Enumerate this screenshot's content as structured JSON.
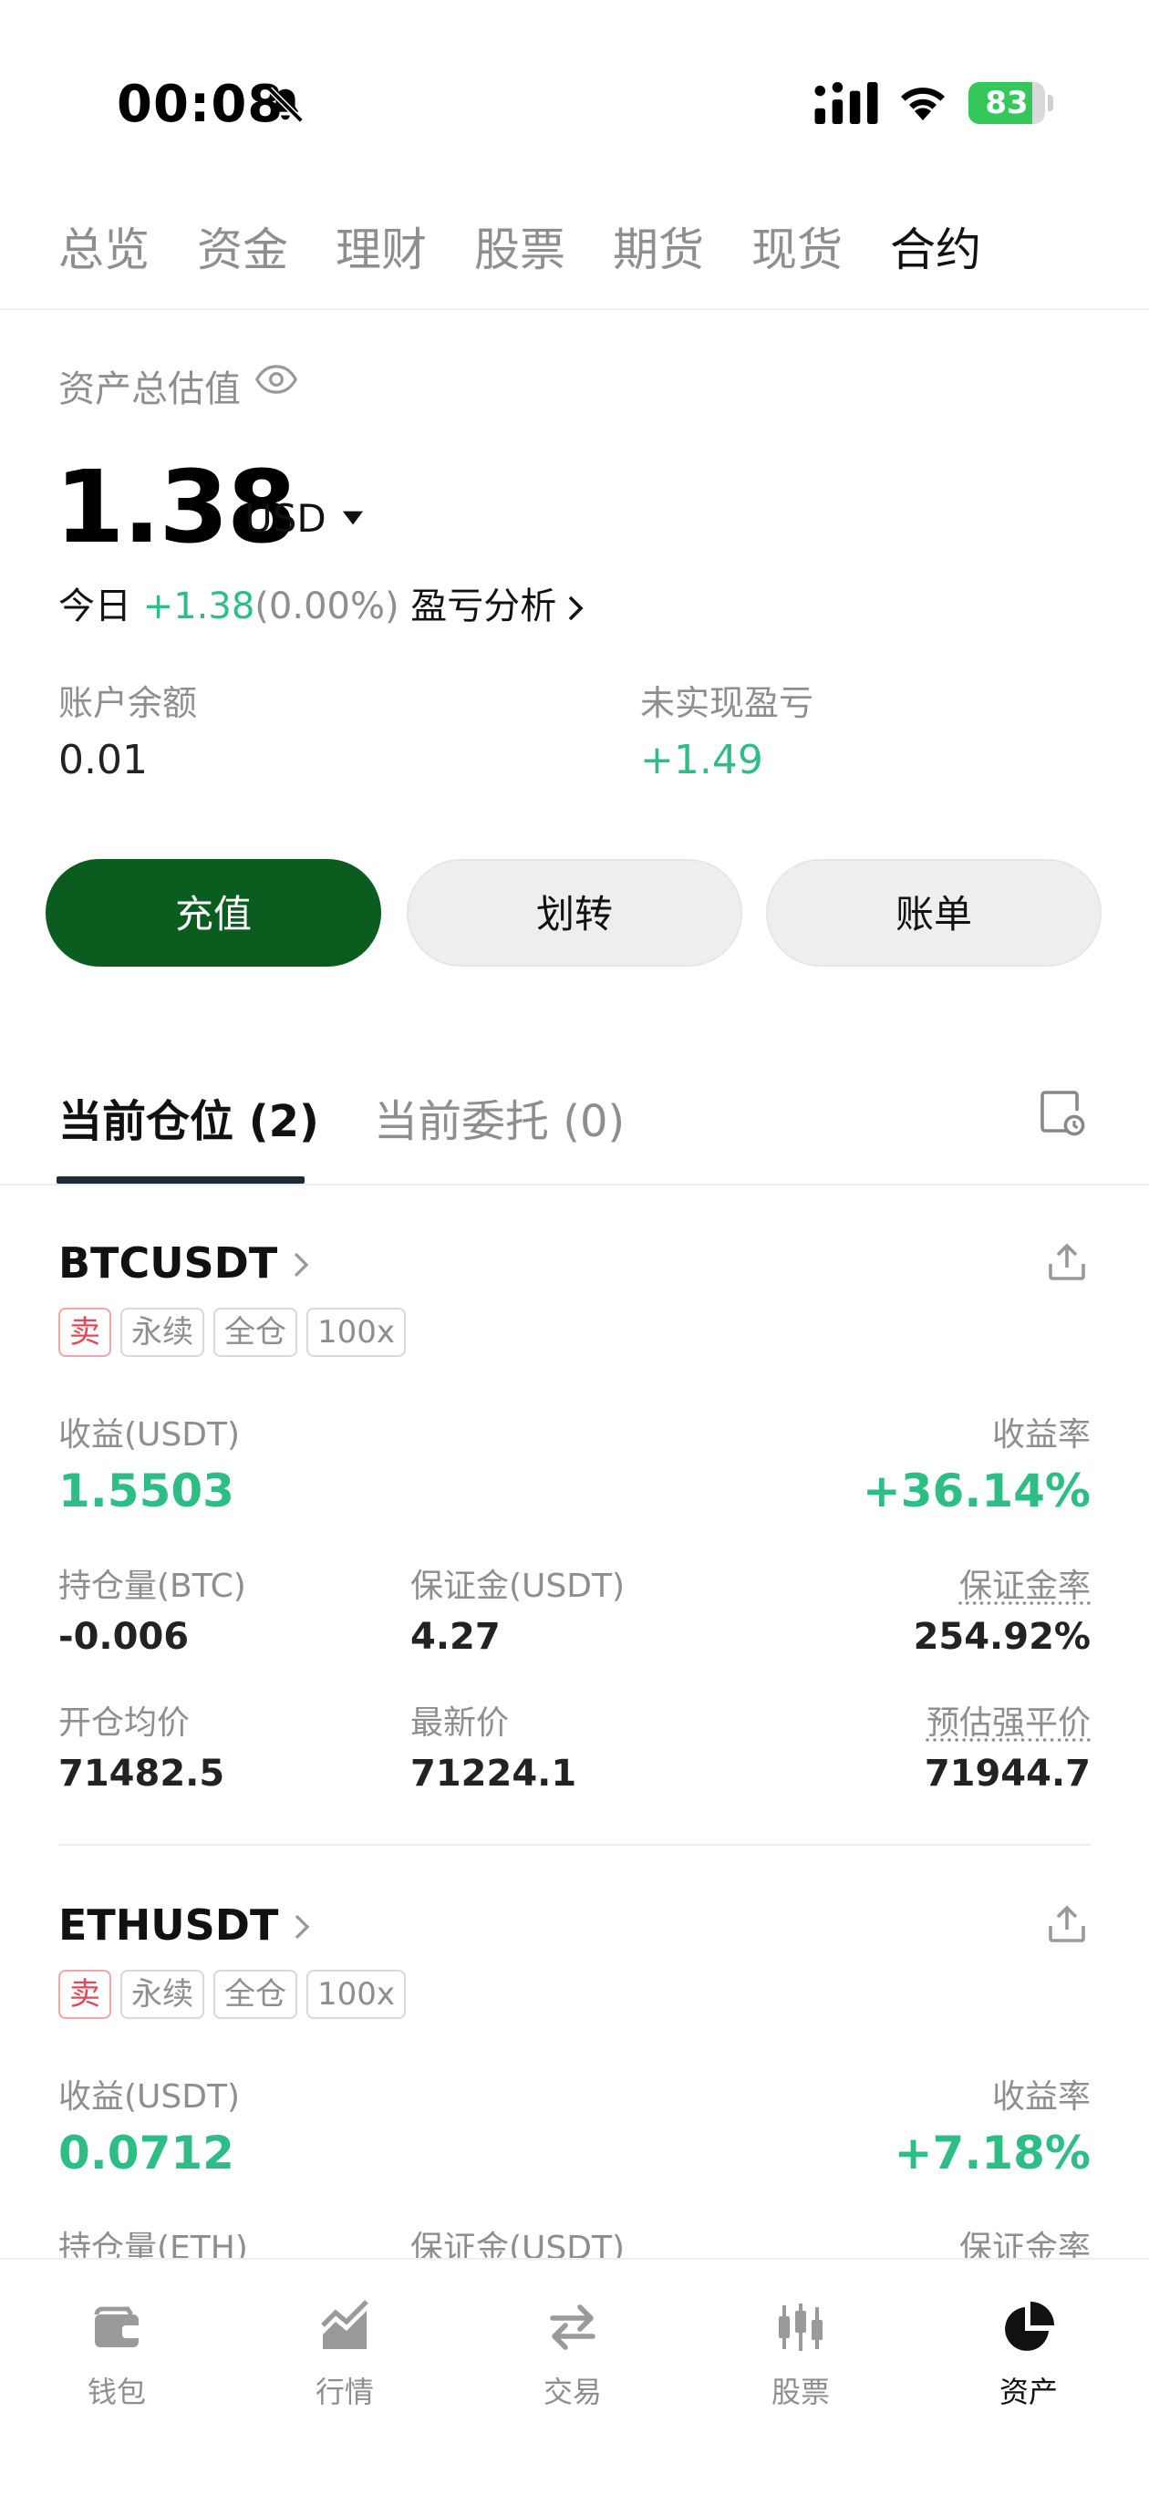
{
  "status_bar": {
    "time": "00:08",
    "battery": "83",
    "battery_level": 0.83
  },
  "top_tabs": [
    {
      "label": "总览"
    },
    {
      "label": "资金"
    },
    {
      "label": "理财"
    },
    {
      "label": "股票"
    },
    {
      "label": "期货"
    },
    {
      "label": "现货"
    },
    {
      "label": "合约",
      "active": true
    }
  ],
  "summary": {
    "label": "资产总估值",
    "value": "1.38",
    "unit": "USD",
    "today_label": "今日",
    "today_change": "+1.38",
    "today_percent": "(0.00%)",
    "analysis_link": "盈亏分析",
    "balance_label": "账户余额",
    "balance_value": "0.01",
    "unrealized_label": "未实现盈亏",
    "unrealized_value": "+1.49"
  },
  "actions": {
    "deposit": "充值",
    "transfer": "划转",
    "bill": "账单"
  },
  "position_tabs": {
    "current_positions": "当前仓位 (2)",
    "current_orders": "当前委托 (0)"
  },
  "positions": [
    {
      "symbol": "BTCUSDT",
      "tags": [
        "卖",
        "永续",
        "全仓",
        "100x"
      ],
      "pnl_label": "收益(USDT)",
      "pnl": "1.5503",
      "roe_label": "收益率",
      "roe": "+36.14%",
      "size_label": "持仓量(BTC)",
      "size": "-0.006",
      "margin_label": "保证金(USDT)",
      "margin": "4.27",
      "margin_ratio_label": "保证金率",
      "margin_ratio": "254.92%",
      "entry_label": "开仓均价",
      "entry": "71482.5",
      "last_label": "最新价",
      "last": "71224.1",
      "liq_label": "预估强平价",
      "liq": "71944.7"
    },
    {
      "symbol": "ETHUSDT",
      "tags": [
        "卖",
        "永续",
        "全仓",
        "100x"
      ],
      "pnl_label": "收益(USDT)",
      "pnl": "0.0712",
      "roe_label": "收益率",
      "roe": "+7.18%",
      "size_label": "持仓量(ETH)",
      "margin_label": "保证金(USDT)",
      "margin_ratio_label": "保证金率"
    }
  ],
  "bottom_nav": [
    {
      "label": "钱包",
      "icon": "wallet-icon"
    },
    {
      "label": "行情",
      "icon": "chart-icon"
    },
    {
      "label": "交易",
      "icon": "swap-icon"
    },
    {
      "label": "股票",
      "icon": "candlestick-icon"
    },
    {
      "label": "资产",
      "icon": "pie-chart-icon",
      "active": true
    }
  ],
  "colors": {
    "accent_green": "#2ebd85",
    "primary_button": "#0b5c1f",
    "sell_red": "#e0485a"
  }
}
